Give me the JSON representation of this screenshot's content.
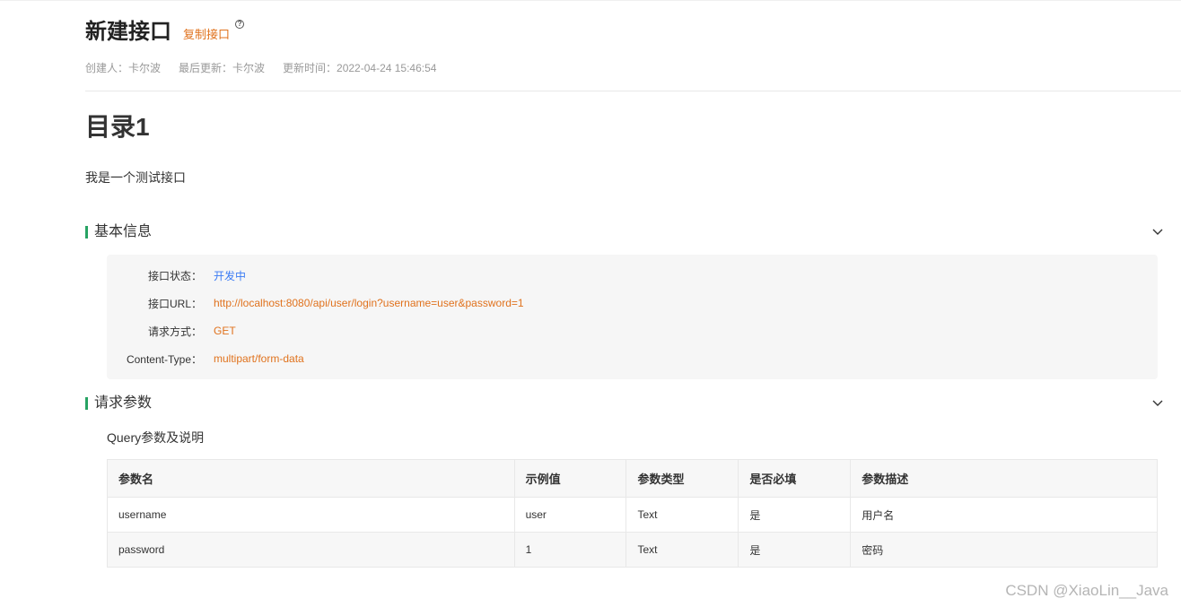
{
  "header": {
    "title": "新建接口",
    "copy_link": "复制接口",
    "help_glyph": "?"
  },
  "meta": {
    "creator": "创建人：卡尔波",
    "last_updater": "最后更新：卡尔波",
    "updated_time": "更新时间：2022-04-24 15:46:54"
  },
  "directory": {
    "title": "目录1",
    "description": "我是一个测试接口"
  },
  "basic_info": {
    "title": "基本信息",
    "rows": [
      {
        "label": "接口状态：",
        "value": "开发中"
      },
      {
        "label": "接口URL：",
        "value": "http://localhost:8080/api/user/login?username=user&password=1"
      },
      {
        "label": "请求方式：",
        "value": "GET"
      },
      {
        "label": "Content-Type：",
        "value": "multipart/form-data"
      }
    ]
  },
  "request_params": {
    "title": "请求参数",
    "query_title": "Query参数及说明",
    "columns": [
      "参数名",
      "示例值",
      "参数类型",
      "是否必填",
      "参数描述"
    ],
    "rows": [
      [
        "username",
        "user",
        "Text",
        "是",
        "用户名"
      ],
      [
        "password",
        "1",
        "Text",
        "是",
        "密码"
      ]
    ]
  },
  "watermark": "CSDN @XiaoLin__Java",
  "colors": {
    "accent_green": "#27a363",
    "link_orange": "#e0721d",
    "status_blue": "#3b7bf4"
  }
}
